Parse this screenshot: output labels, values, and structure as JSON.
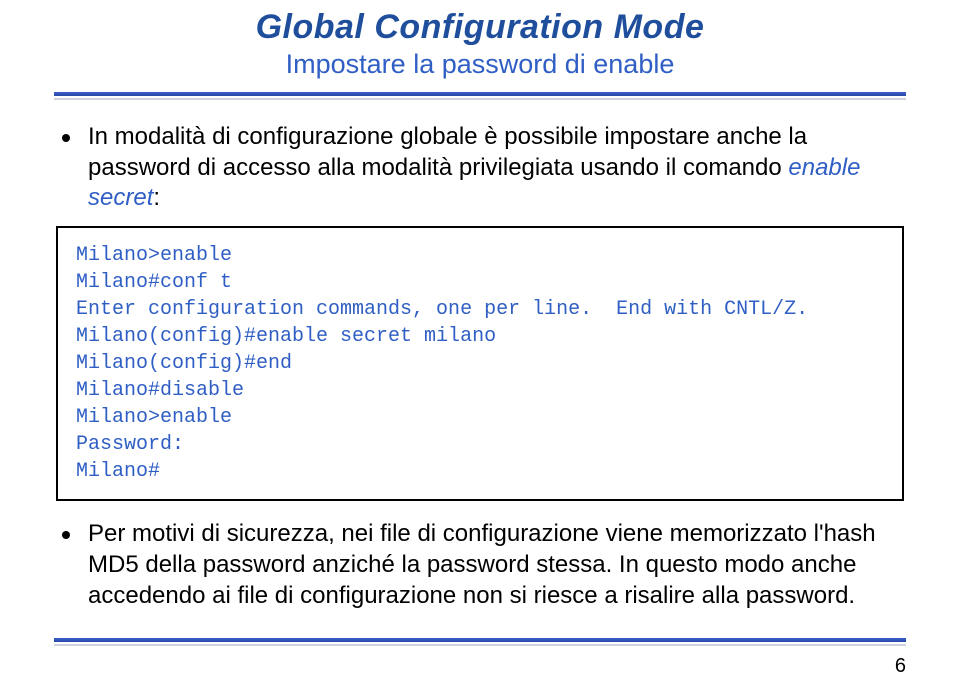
{
  "header": {
    "title": "Global Configuration Mode",
    "subtitle": "Impostare la password di enable"
  },
  "bullets": {
    "intro_prefix": "In modalità di configurazione globale è possibile impostare anche la password di accesso alla modalità privilegiata usando il comando ",
    "intro_cmd": "enable secret",
    "intro_suffix": ":",
    "closing": "Per motivi di sicurezza, nei file di configurazione viene memorizzato l'hash MD5 della password anziché la password stessa. In questo modo anche accedendo ai file di configurazione non si riesce a risalire alla password."
  },
  "code": {
    "l1": "Milano>enable",
    "l2": "Milano#conf t",
    "l3": "Enter configuration commands, one per line.  End with CNTL/Z.",
    "l4": "Milano(config)#enable secret milano",
    "l5": "Milano(config)#end",
    "l6": "Milano#disable",
    "l7": "Milano>enable",
    "l8": "Password:",
    "l9": "Milano#"
  },
  "page_number": "6"
}
